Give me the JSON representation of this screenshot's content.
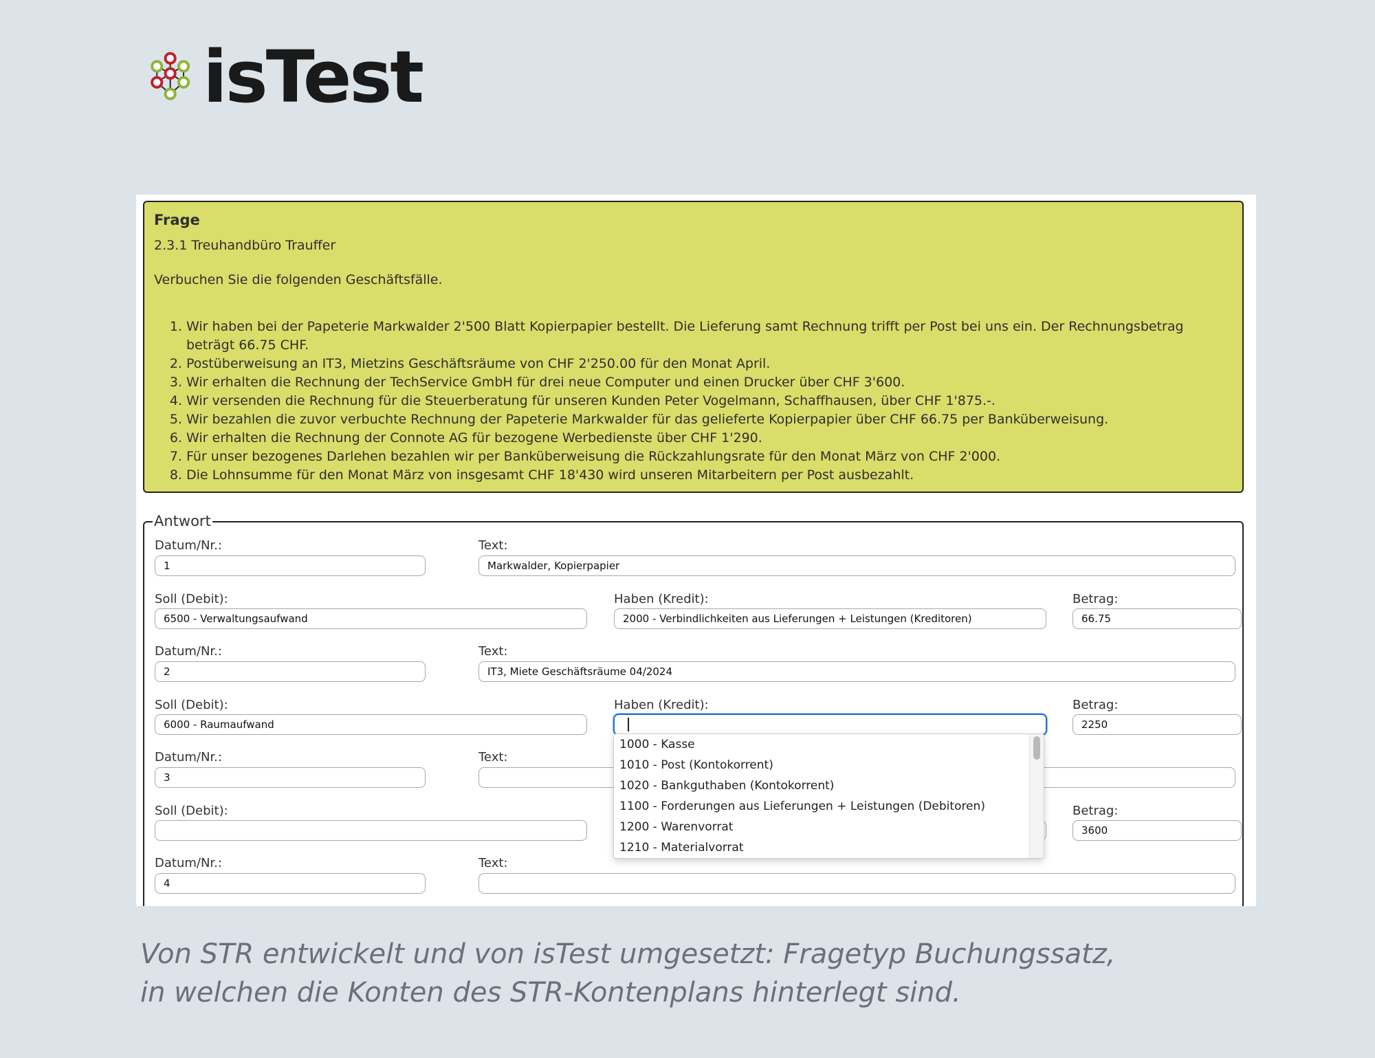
{
  "logo": {
    "text": "isTest"
  },
  "frage": {
    "title": "Frage",
    "subtitle": "2.3.1 Treuhandbüro Trauffer",
    "intro": "Verbuchen Sie die folgenden Geschäftsfälle.",
    "items": [
      "Wir haben bei der Papeterie Markwalder 2'500 Blatt Kopierpapier bestellt. Die Lieferung samt Rechnung trifft per Post bei uns ein. Der Rechnungsbetrag beträgt 66.75 CHF.",
      "Postüberweisung an IT3, Mietzins Geschäftsräume von CHF 2'250.00 für den Monat April.",
      "Wir erhalten die Rechnung der TechService GmbH für drei neue Computer und einen Drucker über CHF 3'600.",
      "Wir versenden die Rechnung für die Steuerberatung für unseren Kunden Peter Vogelmann, Schaffhausen, über CHF 1'875.-.",
      "Wir bezahlen die zuvor verbuchte Rechnung der Papeterie Markwalder für das gelieferte Kopierpapier über CHF 66.75 per Banküberweisung.",
      "Wir erhalten die Rechnung der Connote AG für bezogene Werbedienste über CHF 1'290.",
      "Für unser bezogenes Darlehen bezahlen wir per Banküberweisung die Rückzahlungsrate für den Monat März von CHF 2'000.",
      "Die Lohnsumme für den Monat März von insgesamt CHF 18'430 wird unseren Mitarbeitern per Post ausbezahlt."
    ]
  },
  "antwort": {
    "legend": "Antwort",
    "labels": {
      "datum": "Datum/Nr.:",
      "text": "Text:",
      "soll": "Soll (Debit):",
      "haben": "Haben (Kredit):",
      "betrag": "Betrag:"
    },
    "entries": [
      {
        "datum": "1",
        "text": "Markwalder, Kopierpapier",
        "soll": "6500 - Verwaltungsaufwand",
        "haben": "2000 - Verbindlichkeiten aus Lieferungen + Leistungen (Kreditoren)",
        "betrag": "66.75"
      },
      {
        "datum": "2",
        "text": "IT3, Miete Geschäftsräume 04/2024",
        "soll": "6000 - Raumaufwand",
        "haben": "",
        "betrag": "2250"
      },
      {
        "datum": "3",
        "text": "",
        "soll": "",
        "haben": "",
        "betrag": "3600"
      },
      {
        "datum": "4",
        "text": ""
      }
    ],
    "dropdown_options": [
      "1000 - Kasse",
      "1010 - Post (Kontokorrent)",
      "1020 - Bankguthaben (Kontokorrent)",
      "1100 - Forderungen aus Lieferungen + Leistungen (Debitoren)",
      "1200 - Warenvorrat",
      "1210 - Materialvorrat"
    ]
  },
  "caption": {
    "line1": "Von STR entwickelt und von isTest umgesetzt: Fragetyp Buchungssatz,",
    "line2": "in welchen die Konten des STR-Kontenplans hinterlegt sind."
  }
}
